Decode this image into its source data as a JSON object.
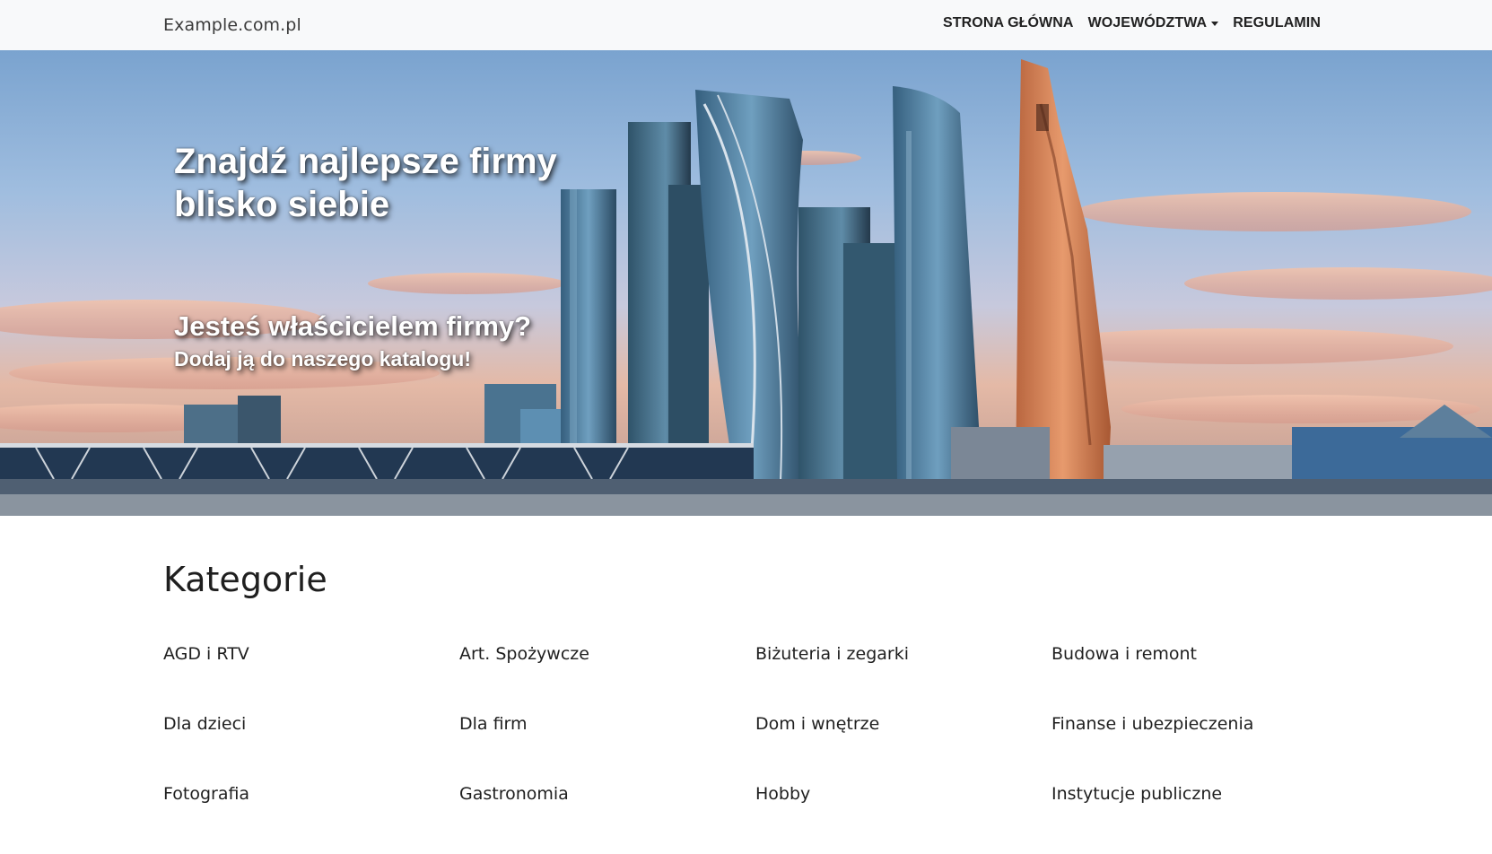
{
  "navbar": {
    "brand": "Example.com.pl",
    "links": {
      "home": "STRONA GŁÓWNA",
      "regions": "WOJEWÓDZTWA",
      "terms": "REGULAMIN"
    }
  },
  "hero": {
    "title_line1": "Znajdź najlepsze firmy",
    "title_line2": "blisko siebie",
    "owner_question": "Jesteś właścicielem firmy?",
    "owner_cta": "Dodaj ją do naszego katalogu!"
  },
  "categories": {
    "title": "Kategorie",
    "items": [
      "AGD i RTV",
      "Art. Spożywcze",
      "Biżuteria i zegarki",
      "Budowa i remont",
      "Dla dzieci",
      "Dla firm",
      "Dom i wnętrze",
      "Finanse i ubezpieczenia",
      "Fotografia",
      "Gastronomia",
      "Hobby",
      "Instytucje publiczne"
    ]
  }
}
